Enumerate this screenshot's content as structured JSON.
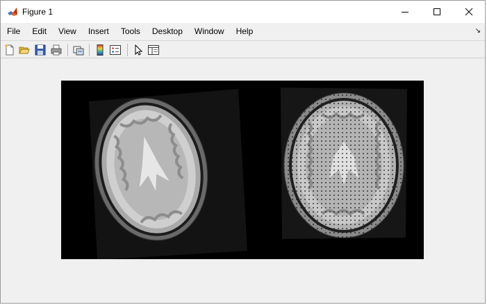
{
  "window": {
    "title": "Figure 1"
  },
  "menu": {
    "items": [
      "File",
      "Edit",
      "View",
      "Insert",
      "Tools",
      "Desktop",
      "Window",
      "Help"
    ]
  },
  "toolbar": {
    "buttons": [
      "new-figure-icon",
      "open-file-icon",
      "save-figure-icon",
      "print-figure-icon",
      "link-plot-icon",
      "insert-colorbar-icon",
      "insert-legend-icon",
      "edit-plot-icon",
      "property-inspector-icon"
    ]
  },
  "figure": {
    "image_description": "",
    "background": "#f0f0f0"
  },
  "colors": {
    "titlebar": "#ffffff",
    "window_bg": "#f0f0f0",
    "image_bg": "#000000"
  }
}
